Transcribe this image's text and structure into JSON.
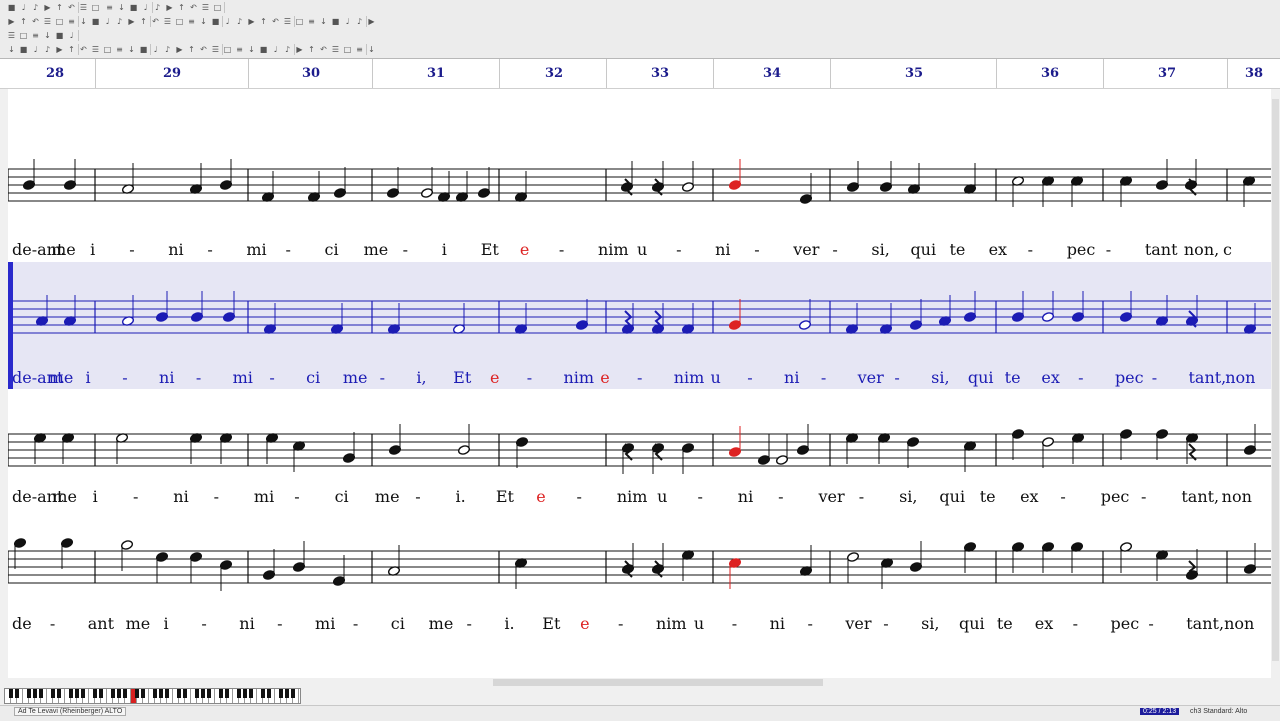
{
  "toolbar": {
    "icons": [
      "cursor-icon",
      "pencil-icon",
      "eraser-icon",
      "note-icon",
      "rest-icon",
      "open-icon",
      "save-icon",
      "print-icon",
      "undo-icon",
      "redo-icon",
      "zoom-in-icon",
      "zoom-out-icon"
    ]
  },
  "ruler": {
    "measures": [
      "28",
      "29",
      "30",
      "31",
      "32",
      "33",
      "34",
      "35",
      "36",
      "37",
      "38"
    ]
  },
  "staves": [
    {
      "selected": false,
      "lyrics": [
        "de-ant",
        "me",
        "i",
        "-",
        "ni",
        "-",
        "mi",
        "-",
        "ci",
        "me",
        "-",
        "i",
        "Et",
        "e",
        "-",
        "nim",
        "u",
        "-",
        "ni",
        "-",
        "ver",
        "-",
        "si,",
        "qui",
        "te",
        "ex",
        "-",
        "pec",
        "-",
        "tant",
        "non,",
        "c"
      ]
    },
    {
      "selected": true,
      "lyrics": [
        "de-ant",
        "me",
        "i",
        "-",
        "ni",
        "-",
        "mi",
        "-",
        "ci",
        "me",
        "-",
        "i,",
        "Et",
        "e",
        "-",
        "nim",
        "e",
        "-",
        "nim",
        "u",
        "-",
        "ni",
        "-",
        "ver",
        "-",
        "si,",
        "qui",
        "te",
        "ex",
        "-",
        "pec",
        "-",
        "tant,",
        "non"
      ]
    },
    {
      "selected": false,
      "lyrics": [
        "de-ant",
        "me",
        "i",
        "-",
        "ni",
        "-",
        "mi",
        "-",
        "ci",
        "me",
        "-",
        "i.",
        "Et",
        "e",
        "-",
        "nim",
        "u",
        "-",
        "ni",
        "-",
        "ver",
        "-",
        "si,",
        "qui",
        "te",
        "ex",
        "-",
        "pec",
        "-",
        "tant,",
        "non"
      ]
    },
    {
      "selected": false,
      "lyrics": [
        "de",
        "-",
        "ant",
        "me",
        "i",
        "-",
        "ni",
        "-",
        "mi",
        "-",
        "ci",
        "me",
        "-",
        "i.",
        "Et",
        "e",
        "-",
        "nim",
        "u",
        "-",
        "ni",
        "-",
        "ver",
        "-",
        "si,",
        "qui",
        "te",
        "ex",
        "-",
        "pec",
        "-",
        "tant,",
        "non"
      ]
    }
  ],
  "status": {
    "file": "Ad Te Levavi (Rheinberger) ALTO",
    "time": "0:25 / 2:13",
    "voice": "ch3 Standard: Alto"
  },
  "colors": {
    "measure_number": "#1c1c8c",
    "selected_staff": "#1c1cb4",
    "highlight": "#dd2222",
    "selected_band": "#e6e6f4"
  }
}
